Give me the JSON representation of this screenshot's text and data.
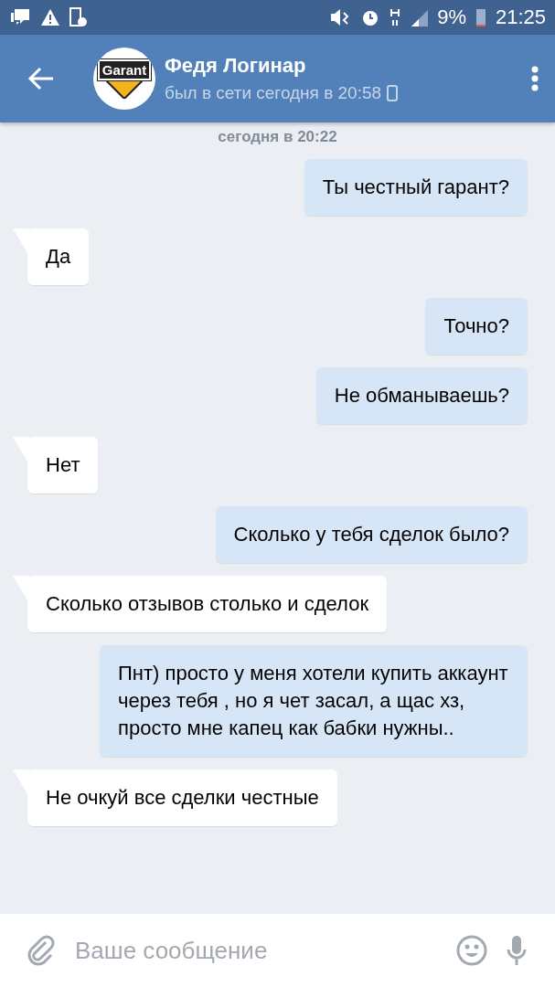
{
  "status_bar": {
    "time": "21:25",
    "battery": "9%"
  },
  "header": {
    "name": "Федя Логинар",
    "status": "был в сети сегодня в 20:58",
    "avatar_text": "Garant"
  },
  "date_divider": "сегодня в 20:22",
  "messages": [
    {
      "outgoing": true,
      "text": "Ты честный гарант?"
    },
    {
      "outgoing": false,
      "text": "Да"
    },
    {
      "outgoing": true,
      "text": "Точно?"
    },
    {
      "outgoing": true,
      "text": "Не обманываешь?"
    },
    {
      "outgoing": false,
      "text": "Нет"
    },
    {
      "outgoing": true,
      "text": "Сколько у тебя сделок было?"
    },
    {
      "outgoing": false,
      "text": "Сколько отзывов столько и сделок"
    },
    {
      "outgoing": true,
      "text": "Пнт) просто у меня хотели купить аккаунт через тебя , но я чет засал, а щас хз, просто мне капец как бабки нужны.."
    },
    {
      "outgoing": false,
      "text": "Не очкуй все сделки честные"
    }
  ],
  "composer": {
    "placeholder": "Ваше сообщение"
  }
}
